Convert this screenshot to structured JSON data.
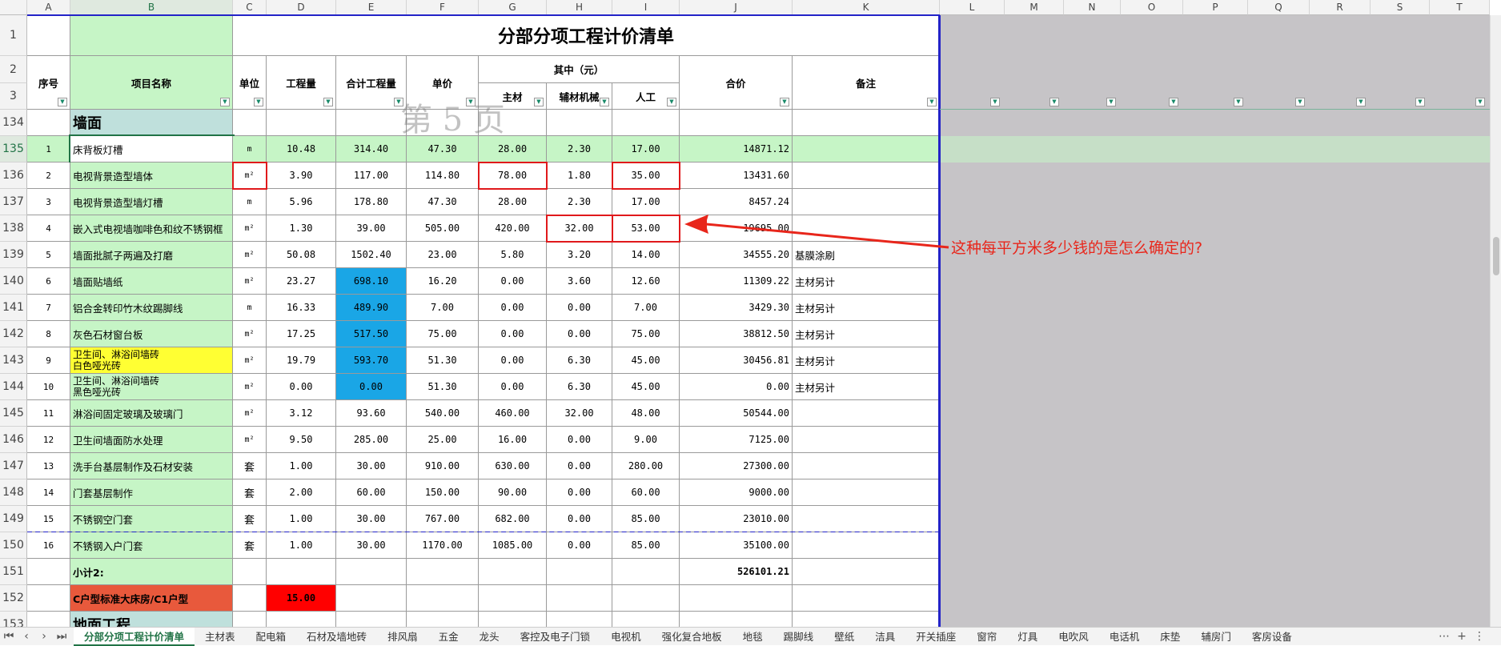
{
  "columns": [
    "A",
    "B",
    "C",
    "D",
    "E",
    "F",
    "G",
    "H",
    "I",
    "J",
    "K",
    "L",
    "M",
    "N",
    "O",
    "P",
    "Q",
    "R",
    "S",
    "T"
  ],
  "title": "分部分项工程计价清单",
  "headers": {
    "seq": "序号",
    "name": "项目名称",
    "unit": "单位",
    "qty": "工程量",
    "total_qty": "合计工程量",
    "price": "单价",
    "of_which": "其中（元）",
    "main": "主材",
    "aux": "辅材机械",
    "labor": "人工",
    "amount": "合价",
    "remark": "备注"
  },
  "watermark": "第 5 页",
  "header_rows": [
    "1",
    "2",
    "3"
  ],
  "section_row": {
    "row": "134",
    "label": "墙面"
  },
  "rows": [
    {
      "row": "135",
      "seq": "1",
      "name": "床背板灯槽",
      "unit": "m",
      "qty": "10.48",
      "total": "314.40",
      "price": "47.30",
      "main": "28.00",
      "aux": "2.30",
      "labor": "17.00",
      "amount": "14871.12",
      "remark": ""
    },
    {
      "row": "136",
      "seq": "2",
      "name": "电视背景造型墙体",
      "unit": "m²",
      "qty": "3.90",
      "total": "117.00",
      "price": "114.80",
      "main": "78.00",
      "aux": "1.80",
      "labor": "35.00",
      "amount": "13431.60",
      "remark": ""
    },
    {
      "row": "137",
      "seq": "3",
      "name": "电视背景造型墙灯槽",
      "unit": "m",
      "qty": "5.96",
      "total": "178.80",
      "price": "47.30",
      "main": "28.00",
      "aux": "2.30",
      "labor": "17.00",
      "amount": "8457.24",
      "remark": ""
    },
    {
      "row": "138",
      "seq": "4",
      "name": "嵌入式电视墙咖啡色和纹不锈钢框",
      "unit": "m²",
      "qty": "1.30",
      "total": "39.00",
      "price": "505.00",
      "main": "420.00",
      "aux": "32.00",
      "labor": "53.00",
      "amount": "19695.00",
      "remark": ""
    },
    {
      "row": "139",
      "seq": "5",
      "name": "墙面批腻子两遍及打磨",
      "unit": "m²",
      "qty": "50.08",
      "total": "1502.40",
      "price": "23.00",
      "main": "5.80",
      "aux": "3.20",
      "labor": "14.00",
      "amount": "34555.20",
      "remark": "基膜涂刷"
    },
    {
      "row": "140",
      "seq": "6",
      "name": "墙面贴墙纸",
      "unit": "m²",
      "qty": "23.27",
      "total": "698.10",
      "price": "16.20",
      "main": "0.00",
      "aux": "3.60",
      "labor": "12.60",
      "amount": "11309.22",
      "remark": "主材另计"
    },
    {
      "row": "141",
      "seq": "7",
      "name": "铝合金转印竹木纹踢脚线",
      "unit": "m",
      "qty": "16.33",
      "total": "489.90",
      "price": "7.00",
      "main": "0.00",
      "aux": "0.00",
      "labor": "7.00",
      "amount": "3429.30",
      "remark": "主材另计"
    },
    {
      "row": "142",
      "seq": "8",
      "name": "灰色石材窗台板",
      "unit": "m²",
      "qty": "17.25",
      "total": "517.50",
      "price": "75.00",
      "main": "0.00",
      "aux": "0.00",
      "labor": "75.00",
      "amount": "38812.50",
      "remark": "主材另计"
    },
    {
      "row": "143",
      "seq": "9",
      "name": "卫生间、淋浴间墙砖\n白色哑光砖",
      "unit": "m²",
      "qty": "19.79",
      "total": "593.70",
      "price": "51.30",
      "main": "0.00",
      "aux": "6.30",
      "labor": "45.00",
      "amount": "30456.81",
      "remark": "主材另计"
    },
    {
      "row": "144",
      "seq": "10",
      "name": "卫生间、淋浴间墙砖\n黑色哑光砖",
      "unit": "m²",
      "qty": "0.00",
      "total": "0.00",
      "price": "51.30",
      "main": "0.00",
      "aux": "6.30",
      "labor": "45.00",
      "amount": "0.00",
      "remark": "主材另计"
    },
    {
      "row": "145",
      "seq": "11",
      "name": "淋浴间固定玻璃及玻璃门",
      "unit": "m²",
      "qty": "3.12",
      "total": "93.60",
      "price": "540.00",
      "main": "460.00",
      "aux": "32.00",
      "labor": "48.00",
      "amount": "50544.00",
      "remark": ""
    },
    {
      "row": "146",
      "seq": "12",
      "name": "卫生间墙面防水处理",
      "unit": "m²",
      "qty": "9.50",
      "total": "285.00",
      "price": "25.00",
      "main": "16.00",
      "aux": "0.00",
      "labor": "9.00",
      "amount": "7125.00",
      "remark": ""
    },
    {
      "row": "147",
      "seq": "13",
      "name": "洗手台基层制作及石材安装",
      "unit": "套",
      "qty": "1.00",
      "total": "30.00",
      "price": "910.00",
      "main": "630.00",
      "aux": "0.00",
      "labor": "280.00",
      "amount": "27300.00",
      "remark": ""
    },
    {
      "row": "148",
      "seq": "14",
      "name": "门套基层制作",
      "unit": "套",
      "qty": "2.00",
      "total": "60.00",
      "price": "150.00",
      "main": "90.00",
      "aux": "0.00",
      "labor": "60.00",
      "amount": "9000.00",
      "remark": ""
    },
    {
      "row": "149",
      "seq": "15",
      "name": "不锈钢空门套",
      "unit": "套",
      "qty": "1.00",
      "total": "30.00",
      "price": "767.00",
      "main": "682.00",
      "aux": "0.00",
      "labor": "85.00",
      "amount": "23010.00",
      "remark": ""
    },
    {
      "row": "150",
      "seq": "16",
      "name": "不锈钢入户门套",
      "unit": "套",
      "qty": "1.00",
      "total": "30.00",
      "price": "1170.00",
      "main": "1085.00",
      "aux": "0.00",
      "labor": "85.00",
      "amount": "35100.00",
      "remark": ""
    }
  ],
  "subtotal": {
    "row": "151",
    "label": "小计2:",
    "amount": "526101.21"
  },
  "room_row": {
    "row": "152",
    "label": "C户型标准大床房/C1户型",
    "value": "15.00"
  },
  "next_section": {
    "row": "153",
    "label": "地面工程"
  },
  "annotation": "这种每平方米多少钱的是怎么确定的?",
  "tabs": [
    "分部分项工程计价清单",
    "主材表",
    "配电箱",
    "石材及墙地砖",
    "排风扇",
    "五金",
    "龙头",
    "客控及电子门锁",
    "电视机",
    "强化复合地板",
    "地毯",
    "踢脚线",
    "壁纸",
    "洁具",
    "开关插座",
    "窗帘",
    "灯具",
    "电吹风",
    "电话机",
    "床垫",
    "辅房门",
    "客房设备"
  ],
  "active_tab": "分部分项工程计价清单",
  "colors": {
    "green": "#c6f5c6",
    "blue_fill": "#1aa6e6",
    "yellow": "#ffff33",
    "red_cell": "#ff0000",
    "orange_cell": "#e8593c",
    "gray": "#c6c4c7",
    "section_teal": "#bfe0dc",
    "select_blue": "#2323c8",
    "red_annot": "#e8261b"
  }
}
